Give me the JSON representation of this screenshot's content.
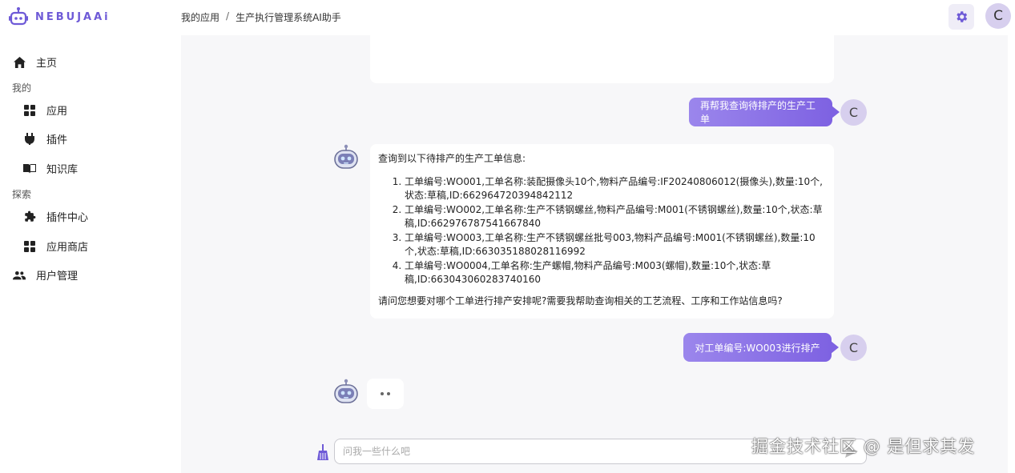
{
  "brand": {
    "name": "NEBUJAAi",
    "color": "#6e5ad7"
  },
  "breadcrumb": [
    "我的应用",
    "生产执行管理系统AI助手"
  ],
  "breadcrumb_sep": "/",
  "user": {
    "initial": "C"
  },
  "sidebar": {
    "home": "主页",
    "section_mine": "我的",
    "apps": "应用",
    "plugins": "插件",
    "knowledge": "知识库",
    "section_explore": "探索",
    "plugin_center": "插件中心",
    "app_store": "应用商店",
    "user_mgmt": "用户管理"
  },
  "chat": {
    "user_msg_1": "再帮我查询待排产的生产工单",
    "bot_intro": "查询到以下待排产的生产工单信息:",
    "orders": [
      "工单编号:WO001,工单名称:装配摄像头10个,物料产品编号:IF20240806012(摄像头),数量:10个,状态:草稿,ID:662964720394842112",
      "工单编号:WO002,工单名称:生产不锈钢螺丝,物料产品编号:M001(不锈钢螺丝),数量:10个,状态:草稿,ID:662976787541667840",
      "工单编号:WO003,工单名称:生产不锈钢螺丝批号003,物料产品编号:M001(不锈钢螺丝),数量:10个,状态:草稿,ID:663035188028116992",
      "工单编号:WO0004,工单名称:生产螺帽,物料产品编号:M003(螺帽),数量:10个,状态:草稿,ID:663043060283740160"
    ],
    "bot_question": "请问您想要对哪个工单进行排产安排呢?需要我帮助查询相关的工艺流程、工序和工作站信息吗?",
    "user_msg_2": "对工单编号:WO003进行排产"
  },
  "input": {
    "placeholder": "问我一些什么吧"
  },
  "watermark": "掘金技术社区 @ 是但求其发",
  "icons": {
    "logo": "robot-logo-icon",
    "settings": "gear-icon",
    "home": "home-icon",
    "apps": "grid-icon",
    "plugins": "plug-icon",
    "knowledge": "book-icon",
    "plugin_center": "puzzle-icon",
    "app_store": "grid-icon",
    "users": "users-icon",
    "bot": "robot-avatar-icon",
    "clear": "broom-icon",
    "send": "send-icon"
  }
}
